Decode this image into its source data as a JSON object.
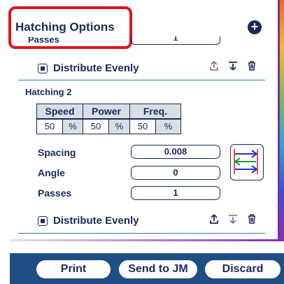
{
  "header": {
    "title": "Hatching Options",
    "add_icon": "plus-circle-icon"
  },
  "hatching1": {
    "passes_label": "Passes",
    "passes_value": "1",
    "distribute_label": "Distribute Evenly",
    "distribute_checked": true
  },
  "hatching2": {
    "title": "Hatching 2",
    "columns": [
      "Speed",
      "Power",
      "Freq."
    ],
    "speed": "50",
    "power": "50",
    "freq": "50",
    "unit": "%",
    "spacing_label": "Spacing",
    "spacing_value": "0.008",
    "angle_label": "Angle",
    "angle_value": "0",
    "passes_label": "Passes",
    "passes_value": "1",
    "distribute_label": "Distribute Evenly",
    "distribute_checked": true
  },
  "footer": {
    "print_label": "Print",
    "send_label": "Send to JM",
    "discard_label": "Discard"
  },
  "colors": {
    "accent": "#1f4e84",
    "text": "#1b2a5a",
    "highlight": "#e0141b"
  }
}
